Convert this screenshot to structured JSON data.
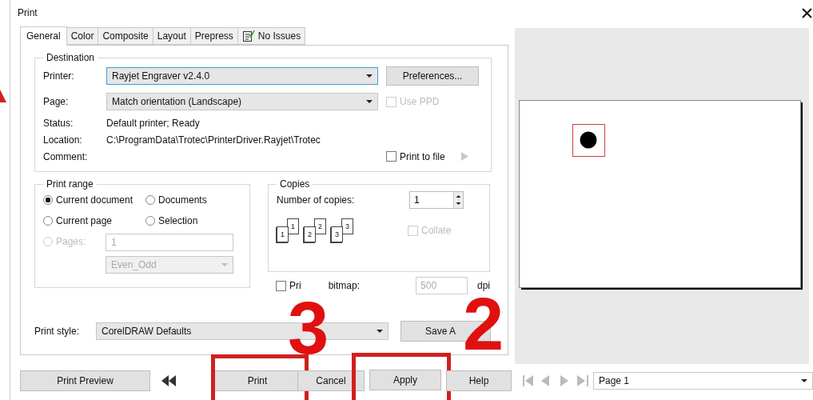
{
  "window": {
    "title": "Print"
  },
  "tabs": [
    {
      "label": "General",
      "selected": true,
      "kind": "plain"
    },
    {
      "label": "Color",
      "selected": false,
      "kind": "plain"
    },
    {
      "label": "Composite",
      "selected": false,
      "kind": "plain"
    },
    {
      "label": "Layout",
      "selected": false,
      "kind": "plain"
    },
    {
      "label": "Prepress",
      "selected": false,
      "kind": "plain"
    },
    {
      "label": "No Issues",
      "selected": false,
      "kind": "issues"
    }
  ],
  "destination": {
    "title": "Destination",
    "fields": [
      {
        "label": "Printer:",
        "kind": "dropdown",
        "value": "Rayjet Engraver v2.4.0",
        "focused": true
      },
      {
        "label": "Page:",
        "kind": "dropdown",
        "value": "Match orientation (Landscape)",
        "focused": false
      },
      {
        "label": "Status:",
        "kind": "text",
        "value": "Default printer; Ready"
      },
      {
        "label": "Location:",
        "kind": "text",
        "value": "C:\\ProgramData\\Trotec\\PrinterDriver.Rayjet\\Trotec"
      },
      {
        "label": "Comment:",
        "kind": "text"
      }
    ],
    "preferences_button": "Preferences...",
    "use_ppd": {
      "label": "Use PPD",
      "checked": false,
      "disabled": true
    },
    "print_to_file": {
      "label": "Print to file",
      "checked": false,
      "disabled": false
    }
  },
  "print_range": {
    "title": "Print range",
    "options": [
      {
        "label": "Current document",
        "selected": true,
        "disabled": false
      },
      {
        "label": "Documents",
        "selected": false,
        "disabled": false
      },
      {
        "label": "Current page",
        "selected": false,
        "disabled": false
      },
      {
        "label": "Selection",
        "selected": false,
        "disabled": false
      },
      {
        "label": "Pages:",
        "selected": false,
        "disabled": true
      }
    ],
    "pages_value": "1",
    "subset": "Even_Odd"
  },
  "copies": {
    "title": "Copies",
    "label": "Number of copies:",
    "value": "1",
    "sheets": [
      [
        "1",
        "1"
      ],
      [
        "2",
        "2"
      ],
      [
        "3",
        "3"
      ]
    ],
    "collate": {
      "label": "Collate",
      "checked": false,
      "disabled": true
    }
  },
  "bitmap": {
    "label_parts": [
      "Pri",
      "bitmap:"
    ],
    "checked": false,
    "value": "500",
    "unit": "dpi",
    "disabled": true
  },
  "print_style": {
    "label": "Print style:",
    "value": "CorelDRAW Defaults",
    "save_button": "Save A"
  },
  "preview_button": "Print Preview",
  "actions": [
    {
      "label": "Print",
      "highlighted": true
    },
    {
      "label": "Cancel",
      "highlighted": false
    },
    {
      "label": "Apply",
      "highlighted": true
    },
    {
      "label": "Help",
      "highlighted": false
    }
  ],
  "page_nav": {
    "value": "Page 1"
  },
  "callouts": [
    "3",
    "2"
  ]
}
